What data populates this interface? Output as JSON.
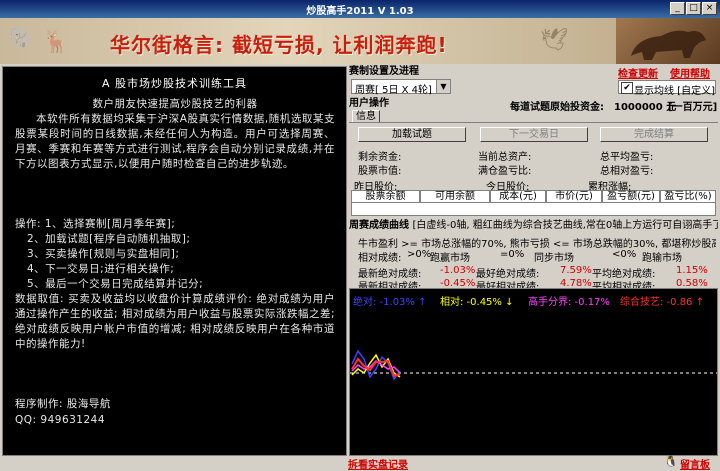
{
  "window": {
    "title": "炒股高手2011 V 1.03",
    "min": "_",
    "max": "□",
    "close": "×"
  },
  "banner": {
    "slogan": "华尔街格言: 截短亏损, 让利润奔跑!"
  },
  "intro": {
    "heading": "A 股市场炒股技术训练工具",
    "p1": "数户朋友快速提高炒股技艺的利器",
    "p2": "本软件所有数据均采集于沪深A股真实行情数据,随机选取某支股票某段时间的日线数据,未经任何人为构造。用户可选择周赛、月赛、季赛和年赛等方式进行测试,程序会自动分别记录成绩,并在下方以图表方式显示,以便用户随时检查自己的进步轨迹。",
    "steps": [
      "操作: 1、选择赛制[周月季年赛];",
      "2、加载试题[程序自动随机抽取];",
      "3、买卖操作[规则与实盘相同];",
      "4、下一交易日;进行相关操作;",
      "5、最后一个交易日完成结算并记分;"
    ],
    "p3": "数据取值: 买卖及收益均以收盘价计算成绩评价: 绝对成绩为用户通过操作产生的收益; 相对成绩为用户收益与股票实际涨跌幅之差; 绝对成绩反映用户帐户市值的增减; 相对成绩反映用户在各种市道中的操作能力!",
    "author": "程序制作: 股海导航",
    "qq": "QQ: 949631244"
  },
  "settings": {
    "section_title": "赛制设置及进程",
    "check_update": "检查更新",
    "help": "使用帮助",
    "mode_value": "周赛[ 5日 X 4轮]",
    "show_ma_label": "显示均线 [自定义]",
    "show_ma_checked": true
  },
  "user_ops": {
    "section_title": "用户操作",
    "capital_label": "每道试题原始投资金:",
    "capital_value": "1000000 元",
    "capital_unit": "[一百万元]",
    "tab_info": "信息",
    "load_button": "加载试题",
    "next_day_button": "下一交易日",
    "settle_button": "完成结算",
    "remain_funds": "剩余资金:",
    "current_assets": "当前总资产:",
    "avg_profit": "总平均盈亏:",
    "stock_value": "股票市值:",
    "full_pos_profit": "满仓盈亏比:",
    "total_rel_profit": "总相对盈亏:",
    "prev_price": "昨日股价:",
    "today_price": "今日股价:",
    "cum_change": "累积涨幅:",
    "table_headers": [
      "股票余额",
      "可用余额",
      "成本(元)",
      "市价(元)",
      "盈亏额(元)",
      "盈亏比(%)"
    ]
  },
  "curve": {
    "section_title": "周赛成绩曲线",
    "section_note": "[白虚线-0轴, 粗红曲线为综合技艺曲线,常在0轴上方运行可自诩高手了!]",
    "bull_line": "牛市盈利 >= 市场总涨幅的70%, 熊市亏损 <= 市场总跌幅的30%, 都堪称炒股高手!",
    "rel_label": "相对成绩:",
    "rel_lead": ">0%",
    "beat_market": "跑赢市场",
    "eq_zero": "=0%",
    "same_market": "同步市场",
    "lt_zero": "<0%",
    "lose_market": "跑输市场",
    "stats": [
      {
        "label": "最新绝对成绩:",
        "value": "-1.03%",
        "label2": "最好绝对成绩:",
        "value2": "7.59%",
        "label3": "平均绝对成绩:",
        "value3": "1.15%"
      },
      {
        "label": "最新相对成绩:",
        "value": "-0.45%",
        "label2": "最好相对成绩:",
        "value2": "4.78%",
        "label3": "平均相对成绩:",
        "value3": "0.58%"
      }
    ],
    "legend": [
      {
        "text": "绝对: -1.03% ↑",
        "color": "#4040ff"
      },
      {
        "text": "相对: -0.45% ↓",
        "color": "#ffff00"
      },
      {
        "text": "高手分界: -0.17%",
        "color": "#ff40ff"
      },
      {
        "text": "综合技艺: -0.86 ↑",
        "color": "#ff3030"
      }
    ]
  },
  "footer": {
    "real_trade": "拆看实盘记录",
    "message": "留言板"
  }
}
